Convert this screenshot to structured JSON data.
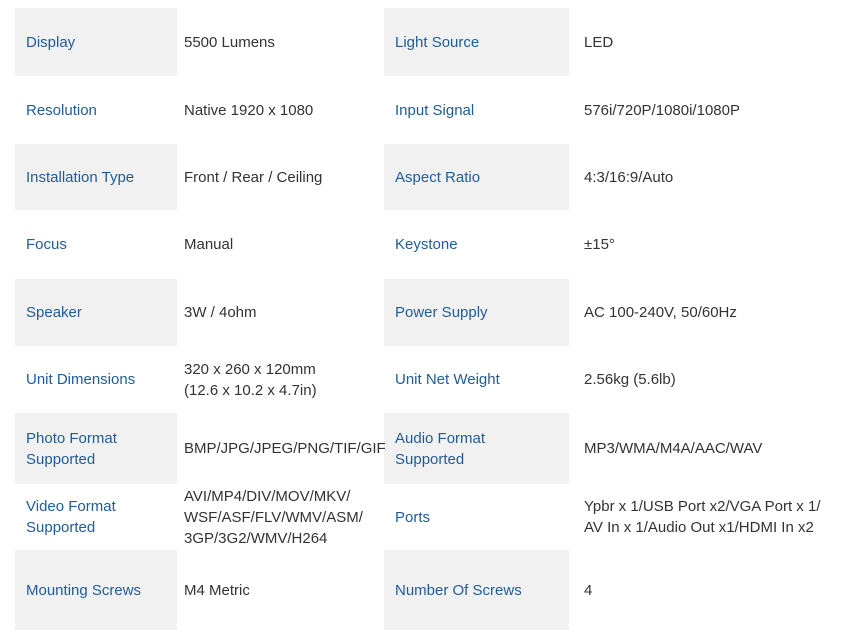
{
  "specs": [
    {
      "label_1": "Display",
      "value_1": "5500 Lumens",
      "label_2": "Light Source",
      "value_2": "LED"
    },
    {
      "label_1": "Resolution",
      "value_1": "Native 1920 x 1080",
      "label_2": "Input Signal",
      "value_2": "576i/720P/1080i/1080P"
    },
    {
      "label_1": "Installation Type",
      "value_1": "Front / Rear / Ceiling",
      "label_2": "Aspect Ratio",
      "value_2": "4:3/16:9/Auto"
    },
    {
      "label_1": "Focus",
      "value_1": "Manual",
      "label_2": "Keystone",
      "value_2": "±15°"
    },
    {
      "label_1": "Speaker",
      "value_1": "3W / 4ohm",
      "label_2": "Power Supply",
      "value_2": "AC 100-240V, 50/60Hz"
    },
    {
      "label_1": "Unit Dimensions",
      "value_1": "320 x 260 x 120mm\n(12.6 x 10.2 x 4.7in)",
      "label_2": "Unit Net Weight",
      "value_2": "2.56kg (5.6lb)"
    },
    {
      "label_1": "Photo Format\nSupported",
      "value_1": "BMP/JPG/JPEG/PNG/TIF/GIF",
      "label_2": "Audio Format\nSupported",
      "value_2": "MP3/WMA/M4A/AAC/WAV"
    },
    {
      "label_1": "Video Format\nSupported",
      "value_1": "AVI/MP4/DIV/MOV/MKV/\nWSF/ASF/FLV/WMV/ASM/\n3GP/3G2/WMV/H264",
      "label_2": "Ports",
      "value_2": "Ypbr x 1/USB Port x2/VGA Port x 1/\nAV In x 1/Audio Out x1/HDMI In x2"
    },
    {
      "label_1": "Mounting Screws",
      "value_1": "M4 Metric",
      "label_2": "Number Of  Screws",
      "value_2": "4"
    }
  ],
  "colors": {
    "label_text": "#1f5c99",
    "value_text": "#333333",
    "row_shade": "#f1f1f1"
  }
}
